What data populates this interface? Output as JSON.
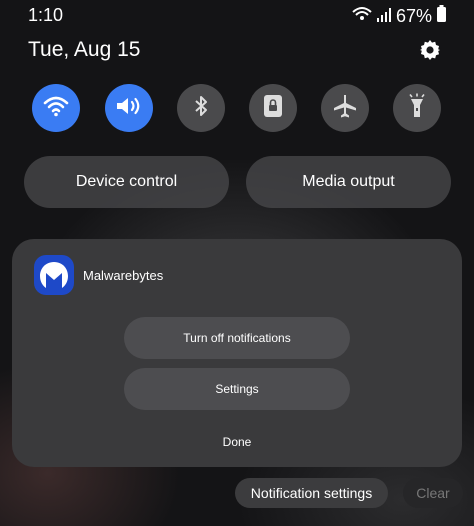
{
  "status_bar": {
    "time": "1:10",
    "battery": "67%"
  },
  "header": {
    "date": "Tue, Aug 15"
  },
  "quick_settings": [
    {
      "name": "wifi",
      "icon": "wifi-icon",
      "state": "on"
    },
    {
      "name": "sound",
      "icon": "volume-icon",
      "state": "on"
    },
    {
      "name": "bluetooth",
      "icon": "bluetooth-icon",
      "state": "off"
    },
    {
      "name": "rotation-lock",
      "icon": "lock-icon",
      "state": "off"
    },
    {
      "name": "airplane-mode",
      "icon": "airplane-icon",
      "state": "off"
    },
    {
      "name": "flashlight",
      "icon": "flashlight-icon",
      "state": "off"
    }
  ],
  "controls": {
    "device_control": "Device control",
    "media_output": "Media output"
  },
  "notification_panel": {
    "app_name": "Malwarebytes",
    "turn_off_label": "Turn off notifications",
    "settings_label": "Settings",
    "done_label": "Done"
  },
  "footer": {
    "notification_settings": "Notification settings",
    "clear": "Clear"
  },
  "colors": {
    "accent": "#3a7cf3",
    "panel": "#3a3a3c",
    "app_icon": "#1e49c8"
  }
}
